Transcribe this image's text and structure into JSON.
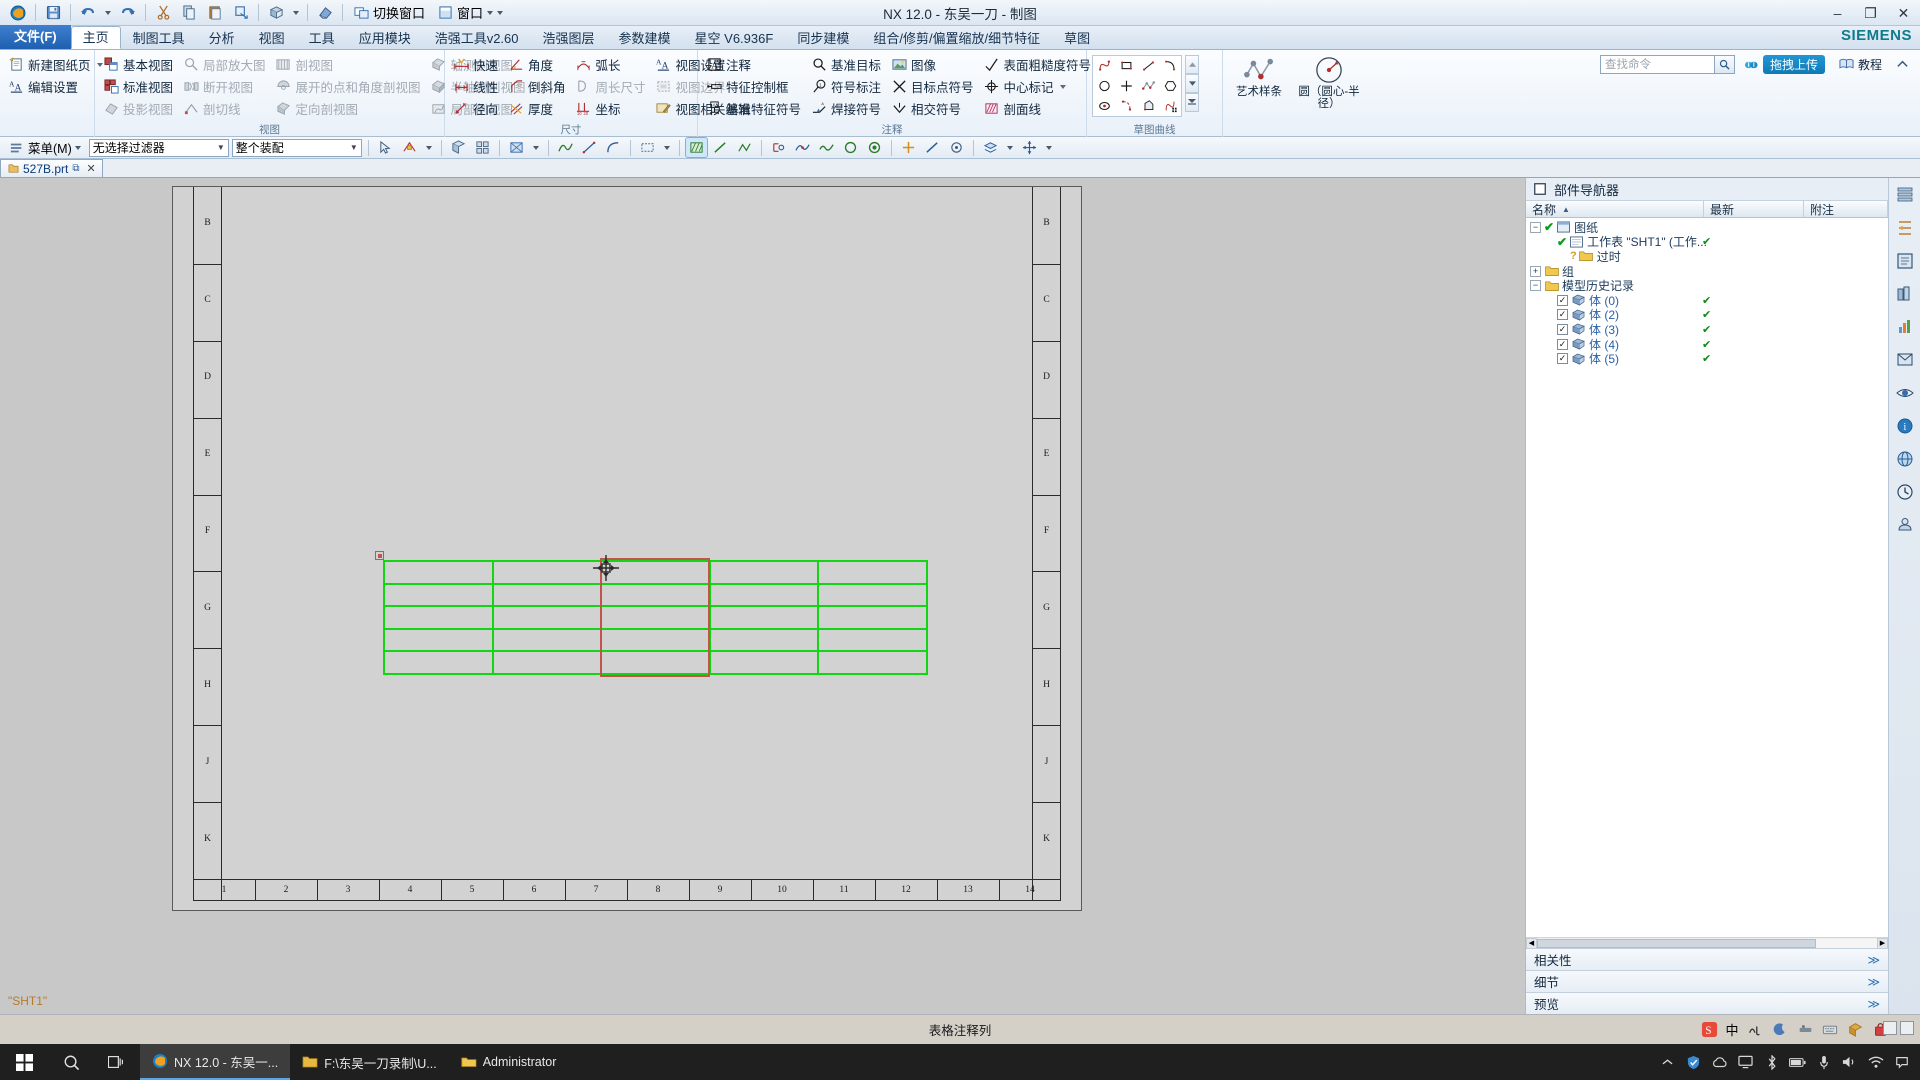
{
  "window": {
    "title": "NX 12.0 - 东吴一刀 - 制图",
    "brand": "SIEMENS",
    "minimize": "–",
    "maximize": "❐",
    "close": "✕"
  },
  "quick_access": [
    {
      "name": "nx-logo-icon",
      "label": ""
    },
    {
      "name": "save-icon",
      "label": ""
    },
    {
      "name": "undo-icon",
      "label": ""
    },
    {
      "name": "redo-icon",
      "label": ""
    },
    {
      "name": "cut-icon",
      "label": ""
    },
    {
      "name": "copy-icon",
      "label": ""
    },
    {
      "name": "paste-icon",
      "label": ""
    },
    {
      "name": "transform-icon",
      "label": ""
    },
    {
      "name": "grid-snap-icon",
      "label": ""
    },
    {
      "name": "eraser-icon",
      "label": ""
    }
  ],
  "quick_access_text": [
    {
      "name": "switch-window-button",
      "label": "切换窗口"
    },
    {
      "name": "window-button",
      "label": "窗口"
    }
  ],
  "tabs": [
    {
      "label": "文件(F)",
      "type": "file"
    },
    {
      "label": "主页",
      "type": "active"
    },
    {
      "label": "制图工具",
      "type": "normal"
    },
    {
      "label": "分析",
      "type": "normal"
    },
    {
      "label": "视图",
      "type": "normal"
    },
    {
      "label": "工具",
      "type": "normal"
    },
    {
      "label": "应用模块",
      "type": "normal"
    },
    {
      "label": "浩强工具v2.60",
      "type": "normal"
    },
    {
      "label": "浩强图层",
      "type": "normal"
    },
    {
      "label": "参数建模",
      "type": "normal"
    },
    {
      "label": "星空 V6.936F",
      "type": "normal"
    },
    {
      "label": "同步建模",
      "type": "normal"
    },
    {
      "label": "组合/修剪/偏置缩放/细节特征",
      "type": "normal"
    },
    {
      "label": "草图",
      "type": "normal"
    }
  ],
  "ribbon": {
    "search_placeholder": "查找命令",
    "upload_label": "拖拽上传",
    "tutorial_label": "教程",
    "groups": [
      {
        "label": "",
        "columns": [
          [
            {
              "label": "新建图纸页",
              "icon": "new-sheet-icon",
              "disabled": false,
              "dropdown": true
            },
            {
              "label": "编辑设置",
              "icon": "edit-settings-icon",
              "disabled": false,
              "dropdown": false
            }
          ]
        ]
      },
      {
        "label": "视图",
        "columns": [
          [
            {
              "label": "基本视图",
              "icon": "base-view-icon",
              "disabled": false
            },
            {
              "label": "标准视图",
              "icon": "standard-view-icon",
              "disabled": false
            },
            {
              "label": "投影视图",
              "icon": "projected-view-icon",
              "disabled": true
            }
          ],
          [
            {
              "label": "局部放大图",
              "icon": "detail-view-icon",
              "disabled": true
            },
            {
              "label": "断开视图",
              "icon": "break-view-icon",
              "disabled": true
            },
            {
              "label": "剖切线",
              "icon": "section-line-icon",
              "disabled": true
            }
          ],
          [
            {
              "label": "剖视图",
              "icon": "section-view-icon",
              "disabled": true
            },
            {
              "label": "展开的点和角度剖视图",
              "icon": "unfolded-section-icon",
              "disabled": true
            },
            {
              "label": "定向剖视图",
              "icon": "oriented-section-icon",
              "disabled": true
            }
          ],
          [
            {
              "label": "轴测剖视图",
              "icon": "iso-section-icon",
              "disabled": true
            },
            {
              "label": "半轴测剖视图",
              "icon": "half-iso-section-icon",
              "disabled": true
            },
            {
              "label": "局部剖视图",
              "icon": "local-section-icon",
              "disabled": true
            }
          ]
        ]
      },
      {
        "label": "尺寸",
        "columns": [
          [
            {
              "label": "快速",
              "icon": "quick-dimension-icon",
              "disabled": false
            },
            {
              "label": "线性",
              "icon": "linear-dimension-icon",
              "disabled": false
            },
            {
              "label": "径向",
              "icon": "radial-dimension-icon",
              "disabled": false
            }
          ],
          [
            {
              "label": "角度",
              "icon": "angular-dimension-icon",
              "disabled": false
            },
            {
              "label": "倒斜角",
              "icon": "chamfer-dimension-icon",
              "disabled": false
            },
            {
              "label": "厚度",
              "icon": "thickness-dimension-icon",
              "disabled": false
            }
          ],
          [
            {
              "label": "弧长",
              "icon": "arc-length-dimension-icon",
              "disabled": false
            },
            {
              "label": "周长尺寸",
              "icon": "perimeter-dimension-icon",
              "disabled": true
            },
            {
              "label": "坐标",
              "icon": "ordinate-dimension-icon",
              "disabled": false
            }
          ],
          [
            {
              "label": "视图设置",
              "icon": "view-settings-icon",
              "disabled": false
            },
            {
              "label": "视图边界",
              "icon": "view-boundary-icon",
              "disabled": true
            },
            {
              "label": "视图相关编辑",
              "icon": "view-dependent-edit-icon",
              "disabled": false
            }
          ]
        ]
      },
      {
        "label": "注释",
        "columns": [
          [
            {
              "label": "注释",
              "icon": "note-icon",
              "disabled": false
            },
            {
              "label": "特征控制框",
              "icon": "feature-control-frame-icon",
              "disabled": false
            },
            {
              "label": "基准特征符号",
              "icon": "datum-feature-symbol-icon",
              "disabled": false
            }
          ],
          [
            {
              "label": "基准目标",
              "icon": "datum-target-icon",
              "disabled": false
            },
            {
              "label": "符号标注",
              "icon": "balloon-icon",
              "disabled": false
            },
            {
              "label": "焊接符号",
              "icon": "weld-symbol-icon",
              "disabled": false
            }
          ],
          [
            {
              "label": "图像",
              "icon": "image-icon",
              "disabled": false
            },
            {
              "label": "目标点符号",
              "icon": "target-point-symbol-icon",
              "disabled": false
            },
            {
              "label": "相交符号",
              "icon": "intersection-symbol-icon",
              "disabled": false
            }
          ],
          [
            {
              "label": "表面粗糙度符号",
              "icon": "surface-finish-symbol-icon",
              "disabled": false
            },
            {
              "label": "中心标记",
              "icon": "center-mark-icon",
              "disabled": false,
              "dropdown": true
            },
            {
              "label": "剖面线",
              "icon": "hatch-icon",
              "disabled": false
            }
          ]
        ]
      },
      {
        "label": "草图曲线",
        "columns": []
      }
    ],
    "sketch_icons": [
      "profile-icon",
      "rectangle-icon",
      "line-icon",
      "arc-icon",
      "circle-icon",
      "point-cross-icon",
      "studio-spline-icon",
      "polygon-icon",
      "ellipse-icon",
      "fillet-arc-icon",
      "offset-curve-icon",
      "pattern-curve-icon"
    ],
    "big_items": [
      {
        "label": "艺术样条",
        "icon": "art-spline-icon"
      },
      {
        "label": "圆（圆心-半径）",
        "icon": "circle-center-radius-icon"
      }
    ]
  },
  "selection_bar": {
    "menu_label": "菜单(M)",
    "filter_value": "无选择过滤器",
    "scope_value": "整个装配",
    "icons": [
      "select-object-icon",
      "snap-point-icon",
      "snap-dropdown-icon",
      "grid-snap-icon",
      "face-select-icon",
      "sketch-line-icon",
      "sketch-arc-icon",
      "spline-icon",
      "curve-icon",
      "wave-icon",
      "full-circle-icon",
      "filled-circle-icon",
      "cross-icon",
      "diagonal-icon",
      "target-icon",
      "display-mode-icon",
      "layer-icon",
      "move-icon"
    ]
  },
  "document_tab": {
    "label": "527B.prt",
    "modified_mark": "⧉",
    "close": "✕"
  },
  "part_navigator": {
    "title": "部件导航器",
    "columns": [
      {
        "label": "名称",
        "sort": "▲"
      },
      {
        "label": "最新"
      },
      {
        "label": "附注"
      }
    ],
    "nodes": [
      {
        "depth": 0,
        "expander": "−",
        "check": "green-check",
        "icon": "drawing-icon",
        "label": "图纸",
        "status": ""
      },
      {
        "depth": 1,
        "expander": "",
        "check": "green-check",
        "icon": "sheet-icon",
        "label": "工作表 \"SHT1\" (工作...",
        "status": "✔"
      },
      {
        "depth": 2,
        "expander": "",
        "check": "question",
        "icon": "folder-icon",
        "label": "过时",
        "status": ""
      },
      {
        "depth": 0,
        "expander": "+",
        "check": "",
        "icon": "folder-icon",
        "label": "组",
        "status": ""
      },
      {
        "depth": 0,
        "expander": "−",
        "check": "",
        "icon": "folder-icon",
        "label": "模型历史记录",
        "status": ""
      },
      {
        "depth": 1,
        "expander": "",
        "check": "checkbox",
        "icon": "body-icon",
        "label": "体 (0)",
        "status": "✔"
      },
      {
        "depth": 1,
        "expander": "",
        "check": "checkbox",
        "icon": "body-icon",
        "label": "体 (2)",
        "status": "✔"
      },
      {
        "depth": 1,
        "expander": "",
        "check": "checkbox",
        "icon": "body-icon",
        "label": "体 (3)",
        "status": "✔"
      },
      {
        "depth": 1,
        "expander": "",
        "check": "checkbox",
        "icon": "body-icon",
        "label": "体 (4)",
        "status": "✔"
      },
      {
        "depth": 1,
        "expander": "",
        "check": "checkbox",
        "icon": "body-icon",
        "label": "体 (5)",
        "status": "✔"
      }
    ],
    "collapsed_sections": [
      {
        "label": "相关性"
      },
      {
        "label": "细节"
      },
      {
        "label": "预览"
      }
    ]
  },
  "resource_rail": [
    "assembly-navigator-icon",
    "constraint-navigator-icon",
    "part-navigator-icon",
    "reuse-library-icon",
    "histogram-icon",
    "view-manager-icon",
    "eye-icon",
    "info-icon",
    "web-icon",
    "history-icon",
    "role-icon"
  ],
  "canvas": {
    "sheet_name": "\"SHT1\"",
    "zone_letters_left": [
      "B",
      "C",
      "D",
      "E",
      "F",
      "G",
      "H",
      "J",
      "K"
    ],
    "zone_letters_right": [
      "B",
      "C",
      "D",
      "E",
      "F",
      "G",
      "H",
      "J",
      "K"
    ],
    "zone_numbers": [
      "1",
      "2",
      "3",
      "4",
      "5",
      "6",
      "7",
      "8",
      "9",
      "10",
      "11",
      "12",
      "13",
      "14"
    ],
    "table_color": "#13d613",
    "selection_color": "#c0564a",
    "table_rows": 5,
    "table_cols": 5
  },
  "status_bar": {
    "message": "表格注释列"
  },
  "tray": {
    "ime_label": "中",
    "icons": [
      "sogou-icon",
      "ime-pinyin-icon",
      "moon-icon",
      "tools-icon",
      "keyboard-icon",
      "box-icon",
      "bag-icon",
      "pen-icon"
    ]
  },
  "taskbar": {
    "start": "start-icon",
    "search": "search-icon",
    "taskview": "task-view-icon",
    "apps": [
      {
        "label": "NX 12.0 - 东吴一...",
        "icon": "nx-icon",
        "active": true
      },
      {
        "label": "F:\\东吴一刀录制\\U...",
        "icon": "folder-icon",
        "active": false
      },
      {
        "label": "Administrator",
        "icon": "explorer-icon",
        "active": false
      }
    ],
    "tray_icons": [
      "chevron-up-icon",
      "shield-icon",
      "cloud-icon",
      "monitor-icon",
      "bluetooth-icon",
      "battery-icon",
      "mic-icon",
      "volume-icon",
      "wifi-icon",
      "notification-icon"
    ]
  }
}
